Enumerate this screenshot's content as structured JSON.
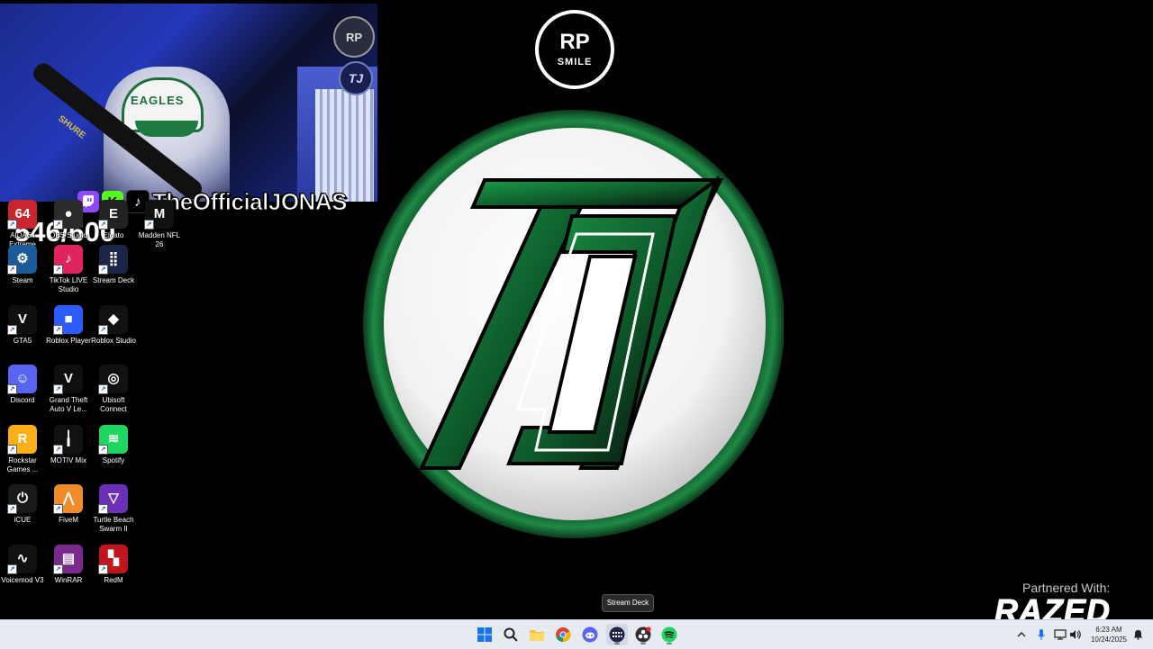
{
  "overlay": {
    "handle": "TheOfficialJONAS",
    "counter": "546/600",
    "platforms": [
      "twitch",
      "kick",
      "tiktok"
    ],
    "mic_brand": "SHURE",
    "hat_text": "EAGLES"
  },
  "top_logo": {
    "primary": "RP",
    "secondary": "SMILE"
  },
  "desktop_icons": [
    {
      "label": "AIDA64 Extreme",
      "icon": "aida64-icon",
      "color": "#c8262e"
    },
    {
      "label": "OBS Studio",
      "icon": "obs-icon",
      "color": "#2b2b2b"
    },
    {
      "label": "Elgato",
      "icon": "elgato-icon",
      "color": "#222222"
    },
    {
      "label": "Madden NFL 26",
      "icon": "madden-icon",
      "color": "#111111"
    },
    {
      "label": "Steam",
      "icon": "steam-icon",
      "color": "#1b5b9a"
    },
    {
      "label": "TikTok LIVE Studio",
      "icon": "tiktok-live-icon",
      "color": "#e0245e"
    },
    {
      "label": "Stream Deck",
      "icon": "stream-deck-icon",
      "color": "#1c2448"
    },
    {
      "label": "GTA5",
      "icon": "gta5-icon",
      "color": "#0f0f0f"
    },
    {
      "label": "Roblox Player",
      "icon": "roblox-player-icon",
      "color": "#2c5cff"
    },
    {
      "label": "Roblox Studio",
      "icon": "roblox-studio-icon",
      "color": "#111111"
    },
    {
      "label": "Discord",
      "icon": "discord-icon",
      "color": "#5865f2"
    },
    {
      "label": "Grand Theft Auto V Le...",
      "icon": "gta-legacy-icon",
      "color": "#0f0f0f"
    },
    {
      "label": "Ubisoft Connect",
      "icon": "ubisoft-icon",
      "color": "#111111"
    },
    {
      "label": "Rockstar Games ...",
      "icon": "rockstar-icon",
      "color": "#fcaf17"
    },
    {
      "label": "MOTIV Mix",
      "icon": "motiv-mix-icon",
      "color": "#111111"
    },
    {
      "label": "Spotify",
      "icon": "spotify-icon",
      "color": "#1ed760"
    },
    {
      "label": "iCUE",
      "icon": "icue-icon",
      "color": "#1a1a1a"
    },
    {
      "label": "FiveM",
      "icon": "fivem-icon",
      "color": "#f08b2c"
    },
    {
      "label": "Turtle Beach Swarm II",
      "icon": "turtle-beach-icon",
      "color": "#6b2fb8"
    },
    {
      "label": "Voicemod V3",
      "icon": "voicemod-icon",
      "color": "#111111"
    },
    {
      "label": "WinRAR",
      "icon": "winrar-icon",
      "color": "#7a2a8c"
    },
    {
      "label": "RedM",
      "icon": "redm-icon",
      "color": "#c0151a"
    }
  ],
  "tooltip": "Stream Deck",
  "partner": {
    "caption": "Partnered With:",
    "brand": "RAZED"
  },
  "taskbar": {
    "apps": [
      "start-icon",
      "search-icon",
      "file-explorer-icon",
      "chrome-icon",
      "discord-icon",
      "stream-deck-icon",
      "obs-icon",
      "spotify-icon"
    ],
    "clock_time": "6:23 AM",
    "clock_date": "10/24/2025"
  },
  "colors": {
    "accent_green": "#1a7a3a",
    "taskbar_bg": "#e6ebf2"
  }
}
